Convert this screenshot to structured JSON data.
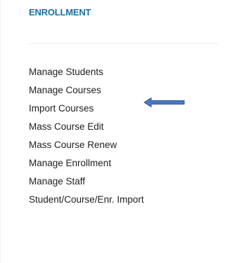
{
  "section": {
    "title": "ENROLLMENT"
  },
  "menu": {
    "items": [
      {
        "label": "Manage Students"
      },
      {
        "label": "Manage Courses"
      },
      {
        "label": "Import Courses"
      },
      {
        "label": "Mass Course Edit"
      },
      {
        "label": "Mass Course Renew"
      },
      {
        "label": "Manage Enrollment"
      },
      {
        "label": "Manage Staff"
      },
      {
        "label": "Student/Course/Enr. Import"
      }
    ]
  },
  "colors": {
    "title": "#1d6fa0",
    "arrow_fill": "#4a78c4",
    "arrow_stroke": "#2e5597",
    "text": "#1f1f1f"
  },
  "annotation": {
    "icon": "left-arrow-icon"
  }
}
